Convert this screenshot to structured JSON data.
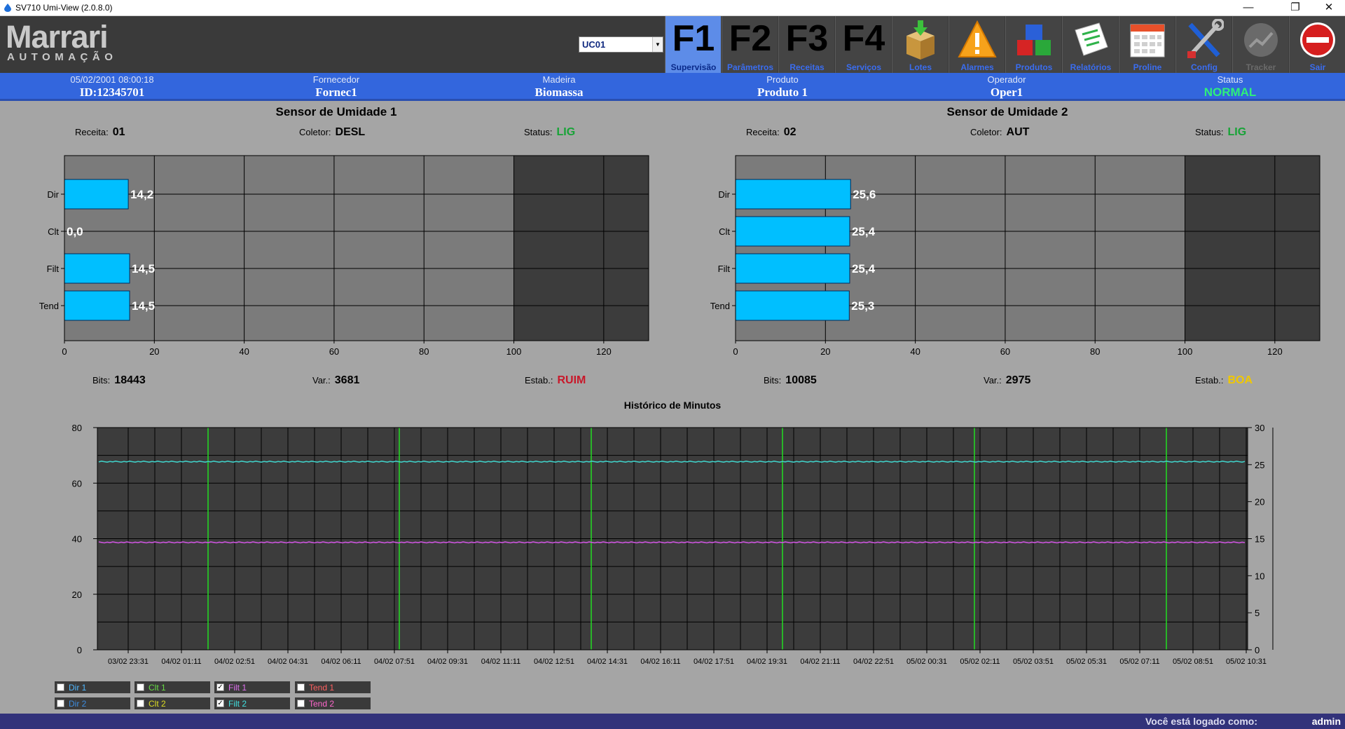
{
  "window": {
    "title": "SV710 Umi-View (2.0.8.0)",
    "minimize": "—",
    "restore": "❐",
    "close": "✕"
  },
  "header": {
    "logo_main": "Marrari",
    "logo_sub": "AUTOMAÇÃO",
    "unit_select": "UC01",
    "nav": [
      {
        "key": "F1",
        "label": "Supervisão"
      },
      {
        "key": "F2",
        "label": "Parâmetros"
      },
      {
        "key": "F3",
        "label": "Receitas"
      },
      {
        "key": "F4",
        "label": "Serviços"
      },
      {
        "icon": "box-icon",
        "label": "Lotes"
      },
      {
        "icon": "warning-icon",
        "label": "Alarmes"
      },
      {
        "icon": "cubes-icon",
        "label": "Produtos"
      },
      {
        "icon": "report-icon",
        "label": "Relatórios"
      },
      {
        "icon": "calendar-icon",
        "label": "Proline"
      },
      {
        "icon": "tools-icon",
        "label": "Config"
      },
      {
        "icon": "tracker-icon",
        "label": "Tracker"
      },
      {
        "icon": "exit-icon",
        "label": "Sair"
      }
    ]
  },
  "info": {
    "datetime": "05/02/2001 08:00:18",
    "id": "ID:12345701",
    "fornecedor_label": "Fornecedor",
    "fornecedor": "Fornec1",
    "madeira_label": "Madeira",
    "madeira": "Biomassa",
    "produto_label": "Produto",
    "produto": "Produto 1",
    "operador_label": "Operador",
    "operador": "Oper1",
    "status_label": "Status",
    "status": "NORMAL"
  },
  "sensors": [
    {
      "title": "Sensor de Umidade 1",
      "receita_label": "Receita:",
      "receita": "01",
      "coletor_label": "Coletor:",
      "coletor": "DESL",
      "status_label": "Status:",
      "status": "LIG",
      "bits_label": "Bits:",
      "bits": "18443",
      "var_label": "Var.:",
      "var": "3681",
      "estab_label": "Estab.:",
      "estab": "RUIM"
    },
    {
      "title": "Sensor de Umidade 2",
      "receita_label": "Receita:",
      "receita": "02",
      "coletor_label": "Coletor:",
      "coletor": "AUT",
      "status_label": "Status:",
      "status": "LIG",
      "bits_label": "Bits:",
      "bits": "10085",
      "var_label": "Var.:",
      "var": "2975",
      "estab_label": "Estab.:",
      "estab": "BOA"
    }
  ],
  "chart_data": [
    {
      "type": "bar",
      "orientation": "horizontal",
      "categories": [
        "Dir",
        "Clt",
        "Filt",
        "Tend"
      ],
      "values": [
        14.2,
        0.0,
        14.5,
        14.5
      ],
      "value_labels": [
        "14,2",
        "0,0",
        "14,5",
        "14,5"
      ],
      "xticks": [
        0,
        20,
        40,
        60,
        80,
        100,
        120
      ],
      "xlim": [
        0,
        130
      ],
      "shaded_region": [
        100,
        130
      ],
      "bar_color": "#00bfff"
    },
    {
      "type": "bar",
      "orientation": "horizontal",
      "categories": [
        "Dir",
        "Clt",
        "Filt",
        "Tend"
      ],
      "values": [
        25.6,
        25.4,
        25.4,
        25.3
      ],
      "value_labels": [
        "25,6",
        "25,4",
        "25,4",
        "25,3"
      ],
      "xticks": [
        0,
        20,
        40,
        60,
        80,
        100,
        120
      ],
      "xlim": [
        0,
        130
      ],
      "shaded_region": [
        100,
        130
      ],
      "bar_color": "#00bfff"
    },
    {
      "type": "line",
      "title": "Histórico de Minutos",
      "x_ticks": [
        "03/02 23:31",
        "04/02 01:11",
        "04/02 02:51",
        "04/02 04:31",
        "04/02 06:11",
        "04/02 07:51",
        "04/02 09:31",
        "04/02 11:11",
        "04/02 12:51",
        "04/02 14:31",
        "04/02 16:11",
        "04/02 17:51",
        "04/02 19:31",
        "04/02 21:11",
        "04/02 22:51",
        "05/02 00:31",
        "05/02 02:11",
        "05/02 03:51",
        "05/02 05:31",
        "05/02 07:11",
        "05/02 08:51",
        "05/02 10:31"
      ],
      "y_left": {
        "ticks": [
          0,
          20,
          40,
          60,
          80
        ],
        "lim": [
          0,
          80
        ]
      },
      "y_right": {
        "ticks": [
          0,
          5,
          10,
          15,
          20,
          25,
          30
        ],
        "lim": [
          0,
          30
        ]
      },
      "series": [
        {
          "name": "Filt 1",
          "value": 14.5,
          "axis": "right",
          "color": "#cc55dd"
        },
        {
          "name": "Filt 2",
          "value": 25.4,
          "axis": "right",
          "color": "#40d0c8"
        }
      ],
      "markers_color": "#22dd22",
      "grid": true
    }
  ],
  "legend": {
    "row1": [
      {
        "label": "Dir 1",
        "checked": false,
        "color": "#4fb8ff"
      },
      {
        "label": "Clt 1",
        "checked": false,
        "color": "#66dd44"
      },
      {
        "label": "Filt 1",
        "checked": true,
        "color": "#e070f0"
      },
      {
        "label": "Tend 1",
        "checked": false,
        "color": "#ff6060"
      }
    ],
    "row2": [
      {
        "label": "Dir 2",
        "checked": false,
        "color": "#3c8ce0"
      },
      {
        "label": "Clt 2",
        "checked": false,
        "color": "#dddd22"
      },
      {
        "label": "Filt 2",
        "checked": true,
        "color": "#40e0e0"
      },
      {
        "label": "Tend 2",
        "checked": false,
        "color": "#ff66cc"
      }
    ],
    "checkmark": "✓"
  },
  "footer": {
    "login_text": "Você está logado como:",
    "user": "admin"
  }
}
